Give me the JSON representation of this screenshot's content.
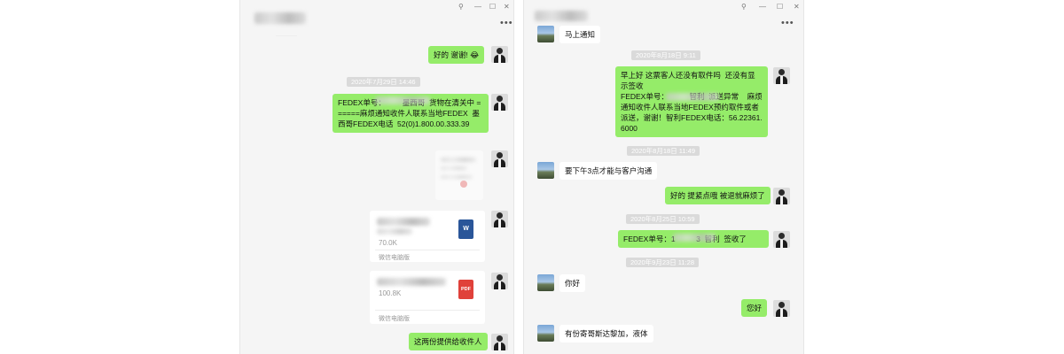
{
  "left_window": {
    "controls": {
      "pin": "⚲",
      "minimize": "—",
      "maximize": "☐",
      "close": "✕",
      "more": "•••"
    },
    "messages": [
      {
        "text": "好的 谢谢! 😂"
      },
      {
        "timestamp": "2020年7月29日 14:46"
      },
      {
        "text": "FEDEX单号：        墨西哥  货物在清关中 ======麻烦通知收件人联系当地FEDEX  墨西哥FEDEX电话  52(0)1.800.00.333.39"
      },
      {
        "attachment": "image"
      },
      {
        "file_size": "70.0K",
        "file_type": "W",
        "source": "微信电脑版"
      },
      {
        "file_size": "100.8K",
        "file_type": "PDF",
        "source": "微信电脑版"
      },
      {
        "text": "这两份提供给收件人"
      }
    ]
  },
  "right_window": {
    "controls": {
      "pin": "⚲",
      "minimize": "—",
      "maximize": "☐",
      "close": "✕",
      "more": "•••"
    },
    "messages": [
      {
        "text": "马上通知"
      },
      {
        "timestamp": "2020年8月18日 9:11"
      },
      {
        "text": "早上好 这票客人还没有取件吗  还没有显示签收\nFEDEX单号：          智利  派送异常    麻烦通知收件人联系当地FEDEX预约取件或者派送，谢谢！智利FEDEX电话：56.22361.6000"
      },
      {
        "timestamp": "2020年8月18日 11:49"
      },
      {
        "text": "要下午3点才能与客户沟通"
      },
      {
        "text": "好的 提紧点哦 被退就麻烦了"
      },
      {
        "timestamp": "2020年8月25日 10:59"
      },
      {
        "text": "FEDEX单号：1          3  智利  签收了"
      },
      {
        "timestamp": "2020年9月23日 11:28"
      },
      {
        "text": "你好"
      },
      {
        "text": "您好"
      },
      {
        "text": "有份寄哥斯达黎加，液体"
      }
    ]
  }
}
